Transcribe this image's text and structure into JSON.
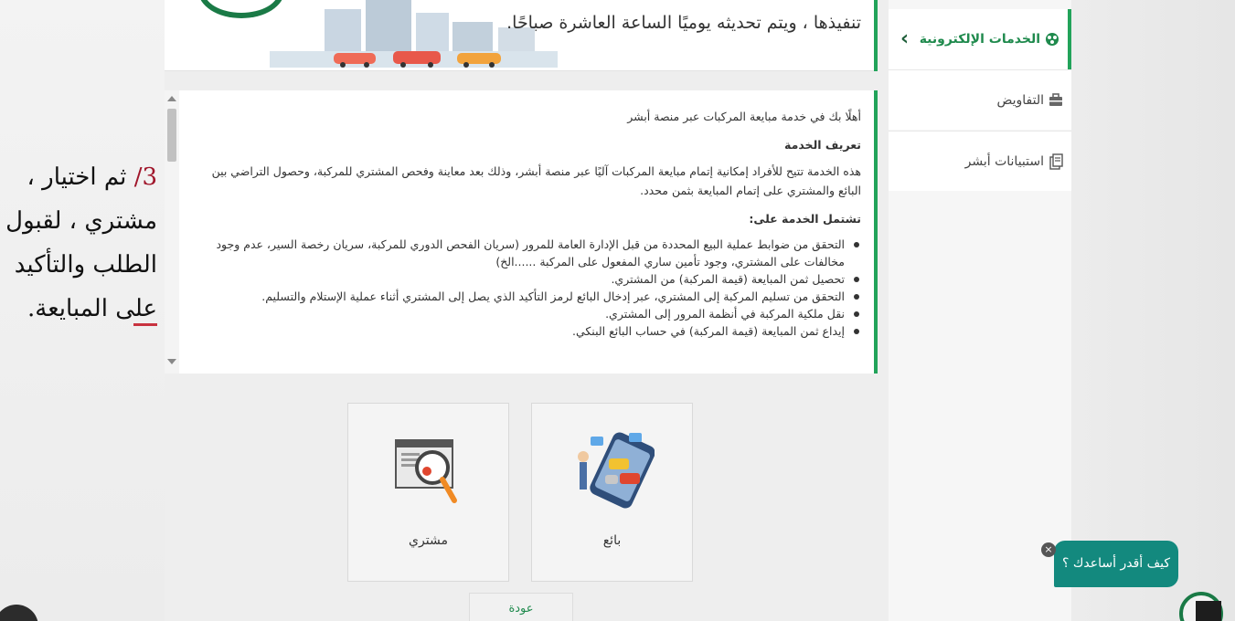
{
  "caption": {
    "number": "3/",
    "text": "ثم اختيار ، مشتري ، لقبول الطلب والتأكيد على المبايعة."
  },
  "banner": {
    "text": "تنفيذها ، ويتم تحديثه يوميًا الساعة العاشرة صباحًا."
  },
  "sidebar": {
    "active_label": "الخدمات الإلكترونية",
    "items": [
      {
        "label": "التفاويض",
        "icon": "briefcase-icon"
      },
      {
        "label": "استبيانات أبشر",
        "icon": "survey-icon"
      }
    ]
  },
  "content": {
    "intro": "أهلًا بك في خدمة مبايعة المركبات عبر منصة أبشر",
    "definition_heading": "تعريف الخدمة",
    "definition_text": "هذه الخدمة تتيح للأفراد إمكانية إتمام مبايعة المركبات آليًا عبر منصة أبشر، وذلك بعد معاينة وفحص المشتري للمركبة، وحصول التراضي بين البائع والمشتري على إتمام المبايعة بثمن محدد.",
    "includes_heading": "تشتمل الخدمة على:",
    "includes": [
      "التحقق من ضوابط عملية البيع المحددة من قبل الإدارة العامة للمرور (سريان الفحص الدوري للمركبة، سريان رخصة السير، عدم وجود مخالفات على المشتري، وجود تأمين ساري المفعول على المركبة ......الخ)",
      "تحصيل ثمن المبايعة (قيمة المركبة) من المشتري.",
      "التحقق من تسليم المركبة إلى المشتري، عبر إدخال البائع لرمز التأكيد الذي يصل إلى المشتري أثناء عملية الإستلام والتسليم.",
      "نقل ملكية المركبة في أنظمة المرور إلى المشتري.",
      "إيداع ثمن المبايعة (قيمة المركبة) في حساب البائع البنكي."
    ]
  },
  "tiles": {
    "buyer_label": "مشتري",
    "seller_label": "بائع"
  },
  "back_label": "عودة",
  "chat": {
    "prompt": "كيف أقدر أساعدك ؟",
    "close_symbol": "×"
  },
  "colors": {
    "accent_green": "#22a35a",
    "chat_teal": "#13897e",
    "caption_red": "#a0162b"
  }
}
